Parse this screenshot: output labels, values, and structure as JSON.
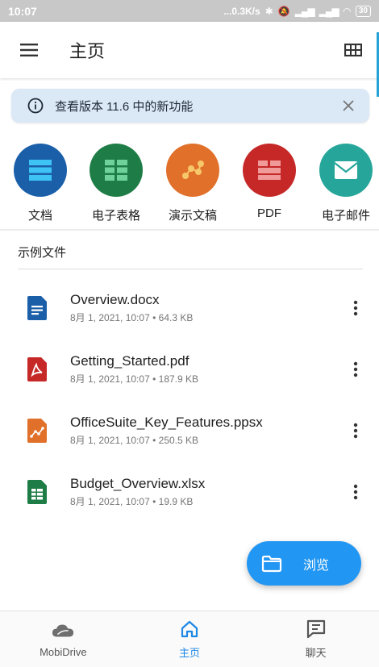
{
  "status_bar": {
    "time": "10:07",
    "network": "...0.3K/s",
    "battery": "30"
  },
  "app_bar": {
    "title": "主页",
    "menu_icon": "hamburger-menu-icon",
    "grid_icon": "grid-view-icon"
  },
  "banner": {
    "text": "查看版本 11.6 中的新功能",
    "info_icon": "info-icon",
    "close_icon": "close-icon"
  },
  "categories": [
    {
      "label": "文档",
      "icon": "document-icon",
      "color": "#1a5fa8"
    },
    {
      "label": "电子表格",
      "icon": "spreadsheet-icon",
      "color": "#1e7d46"
    },
    {
      "label": "演示文稿",
      "icon": "presentation-icon",
      "color": "#e0702a"
    },
    {
      "label": "PDF",
      "icon": "pdf-icon",
      "color": "#c62828"
    },
    {
      "label": "电子邮件",
      "icon": "email-icon",
      "color": "#26a69a"
    }
  ],
  "section_title": "示例文件",
  "files": [
    {
      "name": "Overview.docx",
      "date": "8月 1, 2021, 10:07",
      "size": "64.3 KB",
      "type": "docx",
      "color": "#1a5fa8"
    },
    {
      "name": "Getting_Started.pdf",
      "date": "8月 1, 2021, 10:07",
      "size": "187.9 KB",
      "type": "pdf",
      "color": "#c62828"
    },
    {
      "name": "OfficeSuite_Key_Features.ppsx",
      "date": "8月 1, 2021, 10:07",
      "size": "250.5 KB",
      "type": "ppsx",
      "color": "#e0702a"
    },
    {
      "name": "Budget_Overview.xlsx",
      "date": "8月 1, 2021, 10:07",
      "size": "19.9 KB",
      "type": "xlsx",
      "color": "#1e7d46"
    }
  ],
  "sub_separator": "•",
  "fab": {
    "label": "浏览",
    "icon": "folder-icon"
  },
  "bottom_nav": [
    {
      "label": "MobiDrive",
      "icon": "cloud-icon",
      "active": false
    },
    {
      "label": "主页",
      "icon": "home-icon",
      "active": true
    },
    {
      "label": "聊天",
      "icon": "chat-icon",
      "active": false
    }
  ],
  "colors": {
    "accent": "#1e88e5",
    "banner_bg": "#dbe9f7",
    "fab": "#2196f3"
  }
}
